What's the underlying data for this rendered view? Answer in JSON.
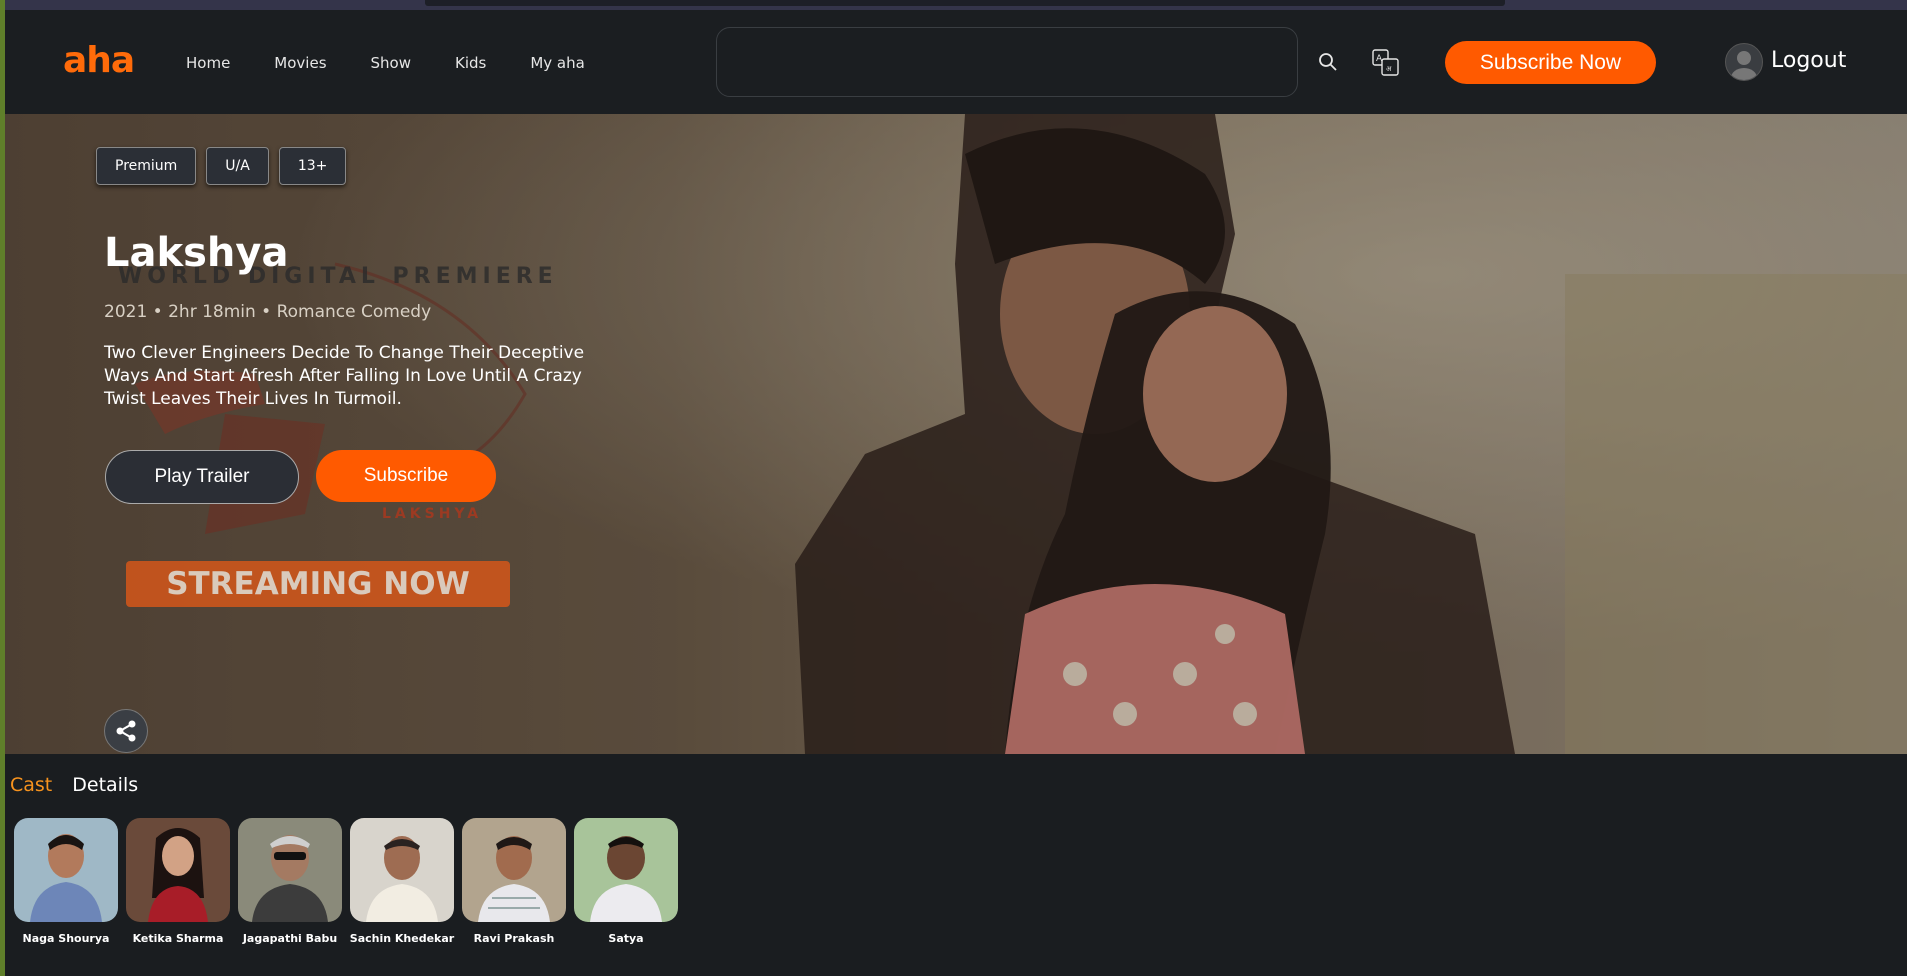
{
  "header": {
    "logo": "aha",
    "nav": [
      "Home",
      "Movies",
      "Show",
      "Kids",
      "My aha"
    ],
    "search_placeholder": "",
    "subscribe_label": "Subscribe Now",
    "logout_label": "Logout"
  },
  "hero": {
    "tags": [
      "Premium",
      "U/A",
      "13+"
    ],
    "title": "Lakshya",
    "premiere_text": "WORLD DIGITAL PREMIERE",
    "meta": "2021 • 2hr 18min • Romance Comedy",
    "description": "Two Clever Engineers Decide To Change Their Deceptive Ways And Start Afresh After Falling In Love Until A Crazy Twist Leaves Their Lives In Turmoil.",
    "play_trailer_label": "Play Trailer",
    "subscribe_label": "Subscribe",
    "lakshya_mark": "LAKSHYA",
    "streaming_text": "STREAMING NOW"
  },
  "tabs": {
    "cast": "Cast",
    "details": "Details"
  },
  "cast": [
    {
      "name": "Naga Shourya"
    },
    {
      "name": "Ketika Sharma"
    },
    {
      "name": "Jagapathi Babu"
    },
    {
      "name": "Sachin Khedekar"
    },
    {
      "name": "Ravi Prakash"
    },
    {
      "name": "Satya"
    }
  ],
  "colors": {
    "accent": "#ff5a00",
    "cast_tab_active": "#f7931e",
    "background": "#1a1d20"
  }
}
